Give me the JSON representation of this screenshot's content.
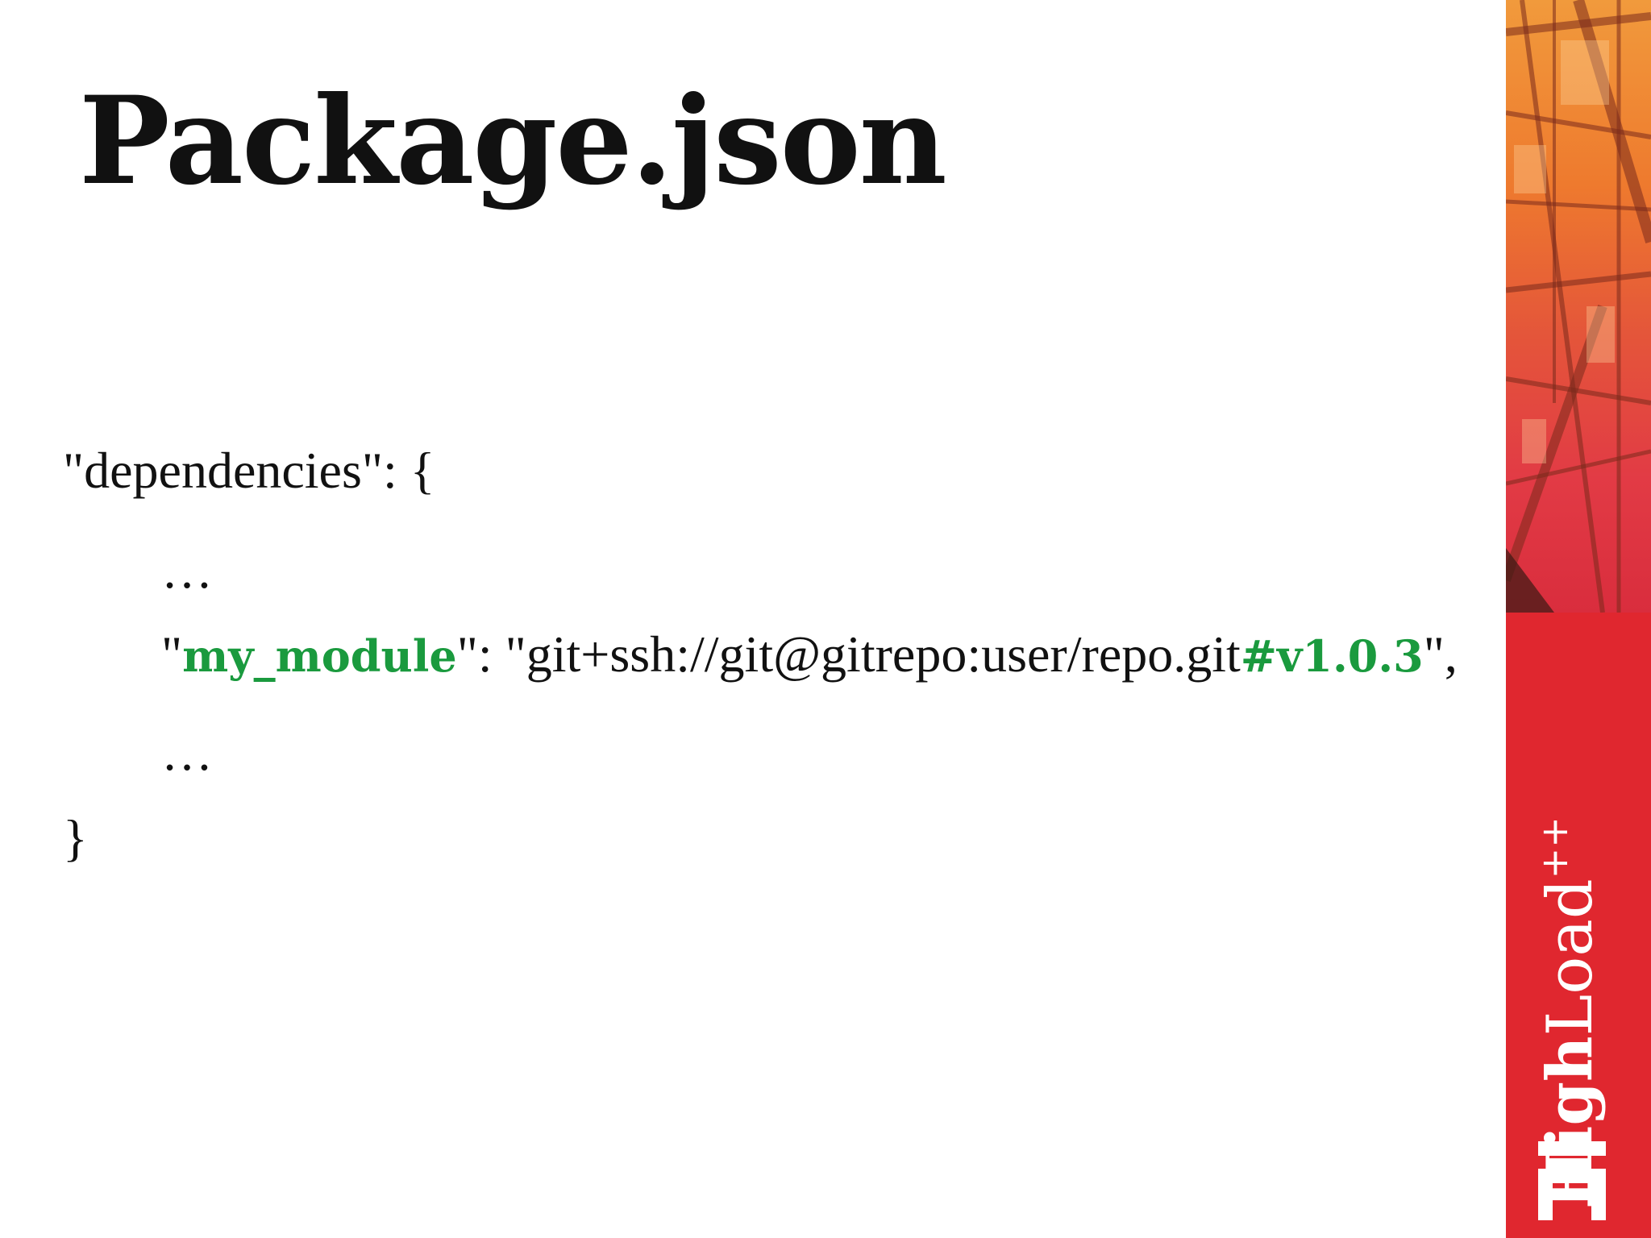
{
  "slide": {
    "title": "Package.json",
    "code": {
      "line1": "\"dependencies\": {",
      "line2": "…",
      "line3_q1": "\"",
      "line3_key": "my_module",
      "line3_mid": "\": \"git+ssh://git@gitrepo:user/repo.git",
      "line3_tag": "#v1.0.3",
      "line3_end": "\",",
      "line4": "…",
      "line5": "}"
    },
    "highlight_color": "#1a9a3e",
    "brand": {
      "bold": "High",
      "light": "Load",
      "sup": "++",
      "color": "#e0272f",
      "logo_icon": "highload-logo-icon"
    }
  }
}
